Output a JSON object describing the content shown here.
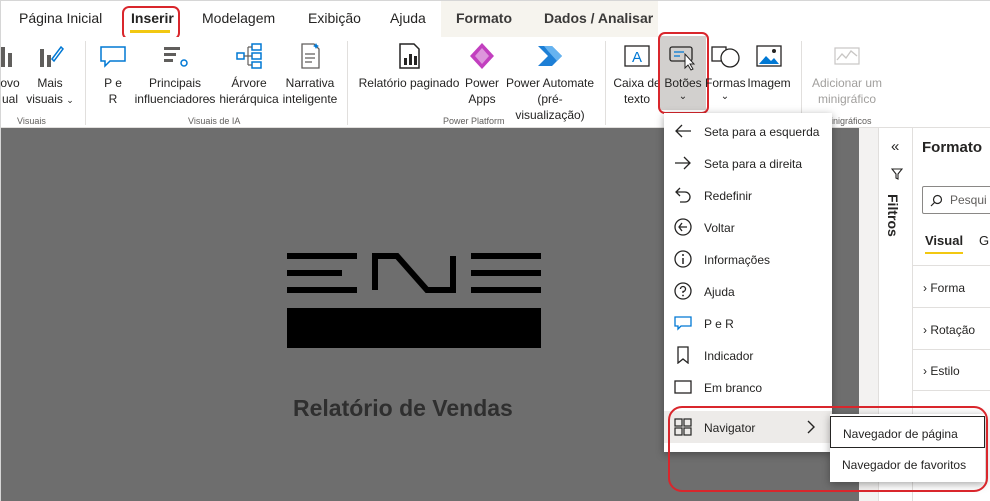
{
  "tabs": [
    {
      "label": "Página Inicial"
    },
    {
      "label": "Inserir"
    },
    {
      "label": "Modelagem"
    },
    {
      "label": "Exibição"
    },
    {
      "label": "Ajuda"
    },
    {
      "label": "Formato"
    },
    {
      "label": "Dados / Analisar"
    }
  ],
  "ribbon": {
    "novo_visual": [
      "ovo",
      "ual"
    ],
    "mais_visuais": [
      "Mais",
      "visuais"
    ],
    "per": [
      "P e",
      "R"
    ],
    "principais": [
      "Principais",
      "influenciadores"
    ],
    "dot": ".",
    "arvore": [
      "Árvore",
      "hierárquica"
    ],
    "narrativa": [
      "Narrativa",
      "inteligente"
    ],
    "relatorio": "Relatório paginado",
    "power_apps": [
      "Power",
      "Apps"
    ],
    "power_automate": [
      "Power Automate",
      "(pré-visualização)"
    ],
    "caixa": [
      "Caixa de",
      "texto"
    ],
    "botoes": "Botões",
    "formas": "Formas",
    "imagem": "Imagem",
    "minigrafico": [
      "Adicionar um",
      "minigráfico"
    ],
    "groups": {
      "visuais": "Visuais",
      "visuais_ia": "Visuais de IA",
      "power_platform": "Power Platform",
      "minigraficos": "inigráficos"
    }
  },
  "canvas": {
    "title": "Relatório de Vendas"
  },
  "filters": {
    "label": "Filtros"
  },
  "format_pane": {
    "title": "Formato",
    "search_placeholder": "Pesqui",
    "tab_visual": "Visual",
    "tab_g": "G",
    "sections": [
      "Forma",
      "Rotação",
      "Estilo"
    ]
  },
  "buttons_menu": {
    "items": [
      {
        "label": "Seta para a esquerda",
        "icon": "arrow-left-icon"
      },
      {
        "label": "Seta para a direita",
        "icon": "arrow-right-icon"
      },
      {
        "label": "Redefinir",
        "icon": "reset-icon"
      },
      {
        "label": "Voltar",
        "icon": "back-circle-icon"
      },
      {
        "label": "Informações",
        "icon": "info-icon"
      },
      {
        "label": "Ajuda",
        "icon": "help-icon"
      },
      {
        "label": "P e R",
        "icon": "qa-icon"
      },
      {
        "label": "Indicador",
        "icon": "bookmark-icon"
      },
      {
        "label": "Em branco",
        "icon": "blank-icon"
      },
      {
        "label": "Navigator",
        "icon": "navigator-icon"
      }
    ],
    "submenu": [
      {
        "label": "Navegador de página"
      },
      {
        "label": "Navegador de favoritos"
      }
    ]
  },
  "colors": {
    "accent_yellow": "#f2c811",
    "highlight_red": "#d9262c",
    "canvas_gray": "#6e6e6e"
  }
}
